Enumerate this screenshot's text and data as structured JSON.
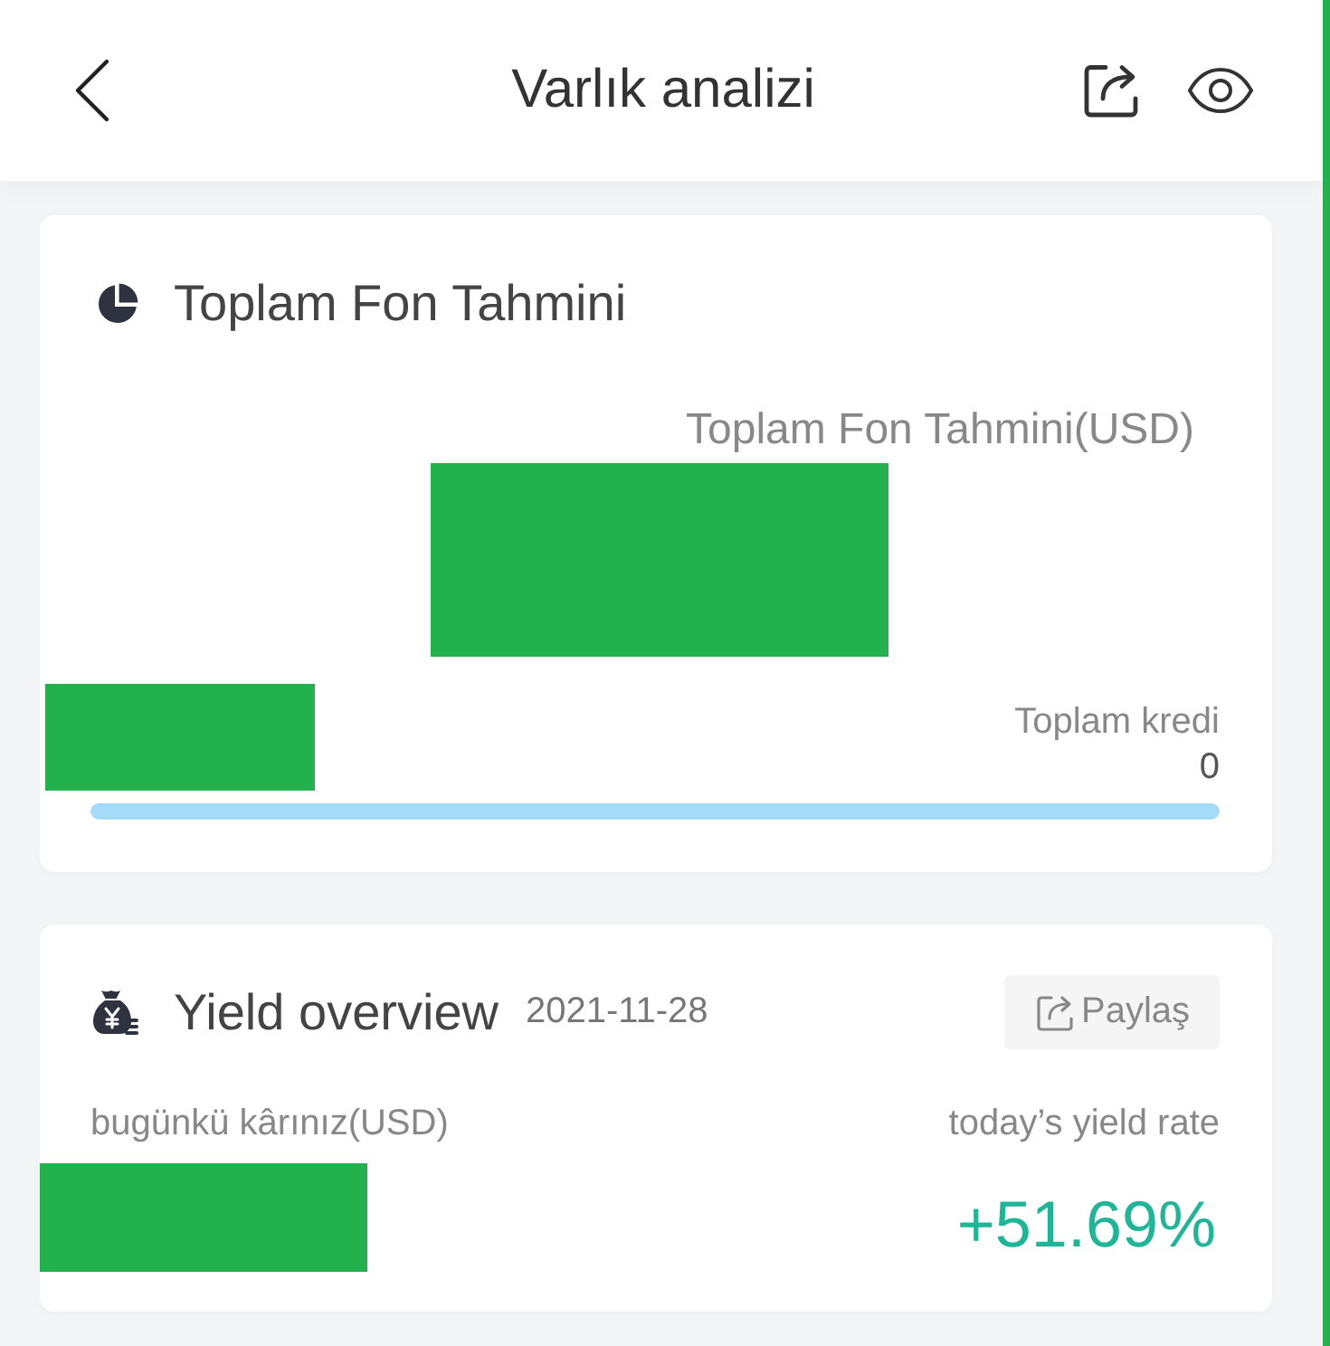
{
  "header": {
    "title": "Varlık analizi"
  },
  "fund_card": {
    "title": "Toplam Fon Tahmini",
    "total_label": "Toplam Fon Tahmini(USD)",
    "credit_label": "Toplam kredi",
    "credit_value": "0",
    "bar": {
      "level": 1
    }
  },
  "yield_card": {
    "title": "Yield overview",
    "date": "2021-11-28",
    "share_button": "Paylaş",
    "profit_label": "bugünkü kârınız(USD)",
    "rate_label": "today’s yield rate",
    "rate_value": "+51.69%"
  }
}
